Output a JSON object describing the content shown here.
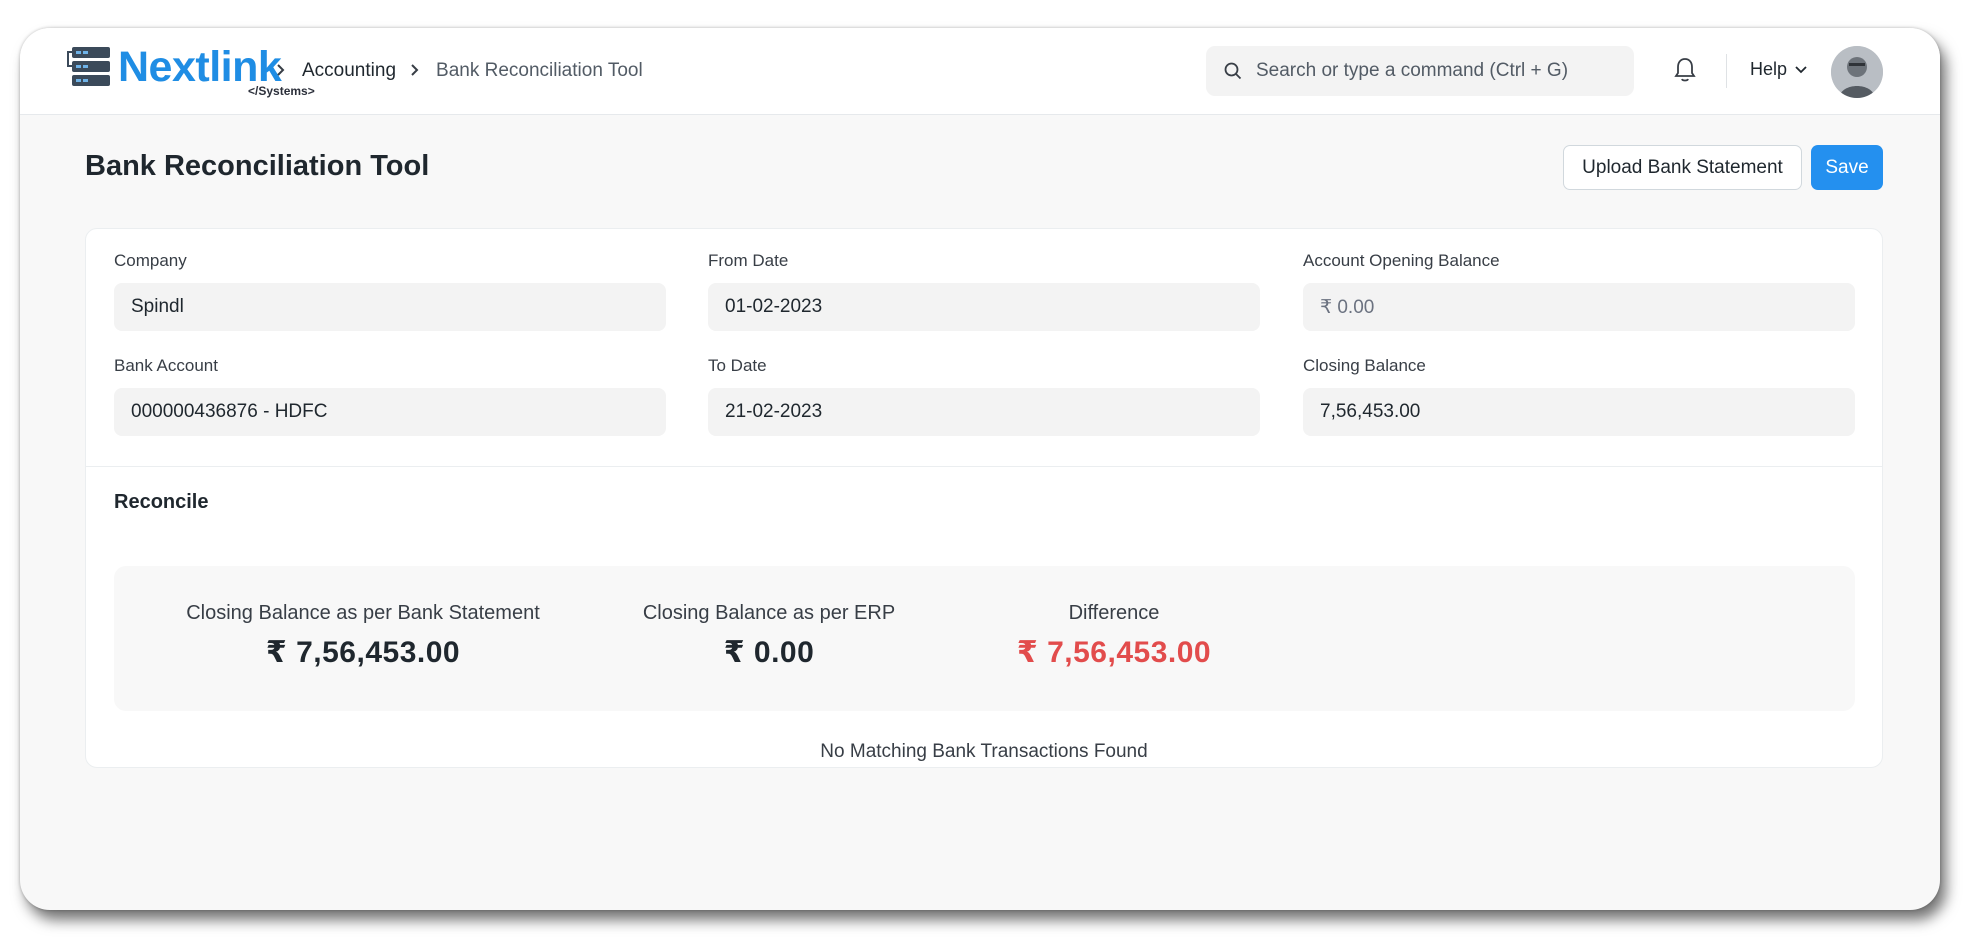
{
  "brand": {
    "name": "Nextlink",
    "tagline": "</Systems>",
    "color": "#1f8de4"
  },
  "breadcrumb": {
    "items": [
      "Accounting",
      "Bank Reconciliation Tool"
    ]
  },
  "search": {
    "placeholder": "Search or type a command (Ctrl + G)",
    "icon": "search-icon"
  },
  "navbar": {
    "notifications_icon": "bell-icon",
    "help_label": "Help"
  },
  "page": {
    "title": "Bank Reconciliation Tool",
    "upload_label": "Upload Bank Statement",
    "save_label": "Save",
    "accent": "#2490ef"
  },
  "form": {
    "company": {
      "label": "Company",
      "value": "Spindl"
    },
    "bank_account": {
      "label": "Bank Account",
      "value": "000000436876 - HDFC"
    },
    "from_date": {
      "label": "From Date",
      "value": "01-02-2023"
    },
    "to_date": {
      "label": "To Date",
      "value": "21-02-2023"
    },
    "opening_balance": {
      "label": "Account Opening Balance",
      "value": "₹ 0.00"
    },
    "closing_balance": {
      "label": "Closing Balance",
      "value": "7,56,453.00"
    }
  },
  "reconcile": {
    "title": "Reconcile",
    "stats": [
      {
        "label": "Closing Balance as per Bank Statement",
        "value": "₹ 7,56,453.00"
      },
      {
        "label": "Closing Balance as per ERP",
        "value": "₹ 0.00"
      },
      {
        "label": "Difference",
        "value": "₹ 7,56,453.00",
        "color": "#e24c4c"
      }
    ],
    "empty_message": "No Matching Bank Transactions Found"
  }
}
